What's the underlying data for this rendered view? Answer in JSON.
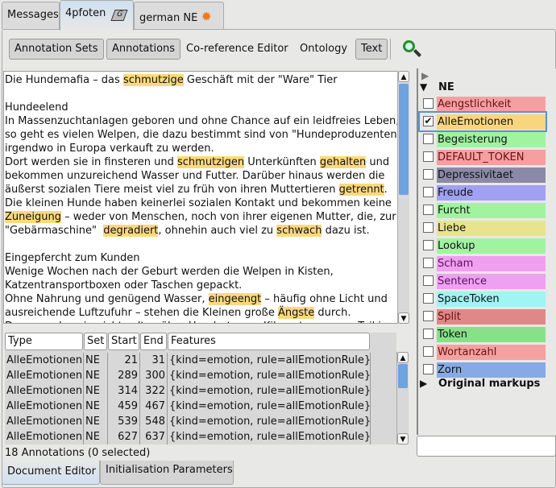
{
  "top_tabs": [
    {
      "label": "Messages"
    },
    {
      "label": "4pfoten",
      "icon": "document-gate-icon"
    },
    {
      "label": "german NE",
      "icon": "gears-icon"
    }
  ],
  "toolbar": {
    "annotation_sets": "Annotation Sets",
    "annotations": "Annotations",
    "coref": "Co-reference Editor",
    "ontology": "Ontology",
    "text": "Text",
    "search_icon": "magnifier-icon"
  },
  "text_lines": [
    [
      {
        "t": "Die Hundemafia – das "
      },
      {
        "t": "schmutzige",
        "hl": true
      },
      {
        "t": " Geschäft mit der \"Ware\" Tier"
      }
    ],
    [
      {
        "t": ""
      }
    ],
    [
      {
        "t": "Hundeelend"
      }
    ],
    [
      {
        "t": "In Massenzuchtanlagen geboren und ohne Chance auf ein leidfreies Leben,"
      }
    ],
    [
      {
        "t": "so geht es vielen Welpen, die dazu bestimmt sind von \"Hundeproduzenten\""
      }
    ],
    [
      {
        "t": "irgendwo in Europa verkauft zu werden."
      }
    ],
    [
      {
        "t": "Dort werden sie in finsteren und "
      },
      {
        "t": "schmutzigen",
        "hl": true
      },
      {
        "t": " Unterkünften "
      },
      {
        "t": "gehalten",
        "hl": true
      },
      {
        "t": " und"
      }
    ],
    [
      {
        "t": "bekommen unzureichend Wasser und Futter. Darüber hinaus werden die"
      }
    ],
    [
      {
        "t": "äußerst sozialen Tiere meist viel zu früh von ihren Muttertieren "
      },
      {
        "t": "getrennt",
        "hl": true
      },
      {
        "t": "."
      }
    ],
    [
      {
        "t": "Die kleinen Hunde haben keinerlei sozialen Kontakt und bekommen keine"
      }
    ],
    [
      {
        "t": "Zuneigung",
        "hl": true
      },
      {
        "t": " – weder von Menschen, noch von ihrer eigenen Mutter, die, zur"
      }
    ],
    [
      {
        "t": "\"Gebärmaschine\"  "
      },
      {
        "t": "degradiert",
        "hl": true
      },
      {
        "t": ", ohnehin auch viel zu "
      },
      {
        "t": "schwach",
        "hl": true
      },
      {
        "t": " dazu ist."
      }
    ],
    [
      {
        "t": ""
      }
    ],
    [
      {
        "t": "Eingepfercht zum Kunden"
      }
    ],
    [
      {
        "t": "Wenige Wochen nach der Geburt werden die Welpen in Kisten,"
      }
    ],
    [
      {
        "t": "Katzentransportboxen oder Taschen gepackt."
      }
    ],
    [
      {
        "t": "Ohne Nahrung und genügend Wasser, "
      },
      {
        "t": "eingeengt",
        "hl": true
      },
      {
        "t": " – häufig ohne Licht und"
      }
    ],
    [
      {
        "t": "ausreichende Luftzufuhr – stehen die Kleinen große "
      },
      {
        "t": "Ängste",
        "hl": true
      },
      {
        "t": " durch."
      }
    ],
    [
      {
        "t": "Dann werden sie nicht selten über Hunderte von Kilometern – zum Teil ins"
      }
    ]
  ],
  "table": {
    "columns": [
      "Type",
      "Set",
      "Start",
      "End",
      "Features"
    ],
    "rows": [
      [
        "AlleEmotionen",
        "NE",
        "21",
        "31",
        "{kind=emotion, rule=allEmotionRule}"
      ],
      [
        "AlleEmotionen",
        "NE",
        "289",
        "300",
        "{kind=emotion, rule=allEmotionRule}"
      ],
      [
        "AlleEmotionen",
        "NE",
        "314",
        "322",
        "{kind=emotion, rule=allEmotionRule}"
      ],
      [
        "AlleEmotionen",
        "NE",
        "459",
        "467",
        "{kind=emotion, rule=allEmotionRule}"
      ],
      [
        "AlleEmotionen",
        "NE",
        "539",
        "548",
        "{kind=emotion, rule=allEmotionRule}"
      ],
      [
        "AlleEmotionen",
        "NE",
        "627",
        "637",
        "{kind=emotion, rule=allEmotionRule}"
      ]
    ]
  },
  "status": "18 Annotations (0 selected)",
  "bottom_tabs": [
    "Document Editor",
    "Initialisation Parameters"
  ],
  "sets": {
    "group": "NE",
    "other": "Original markups",
    "items": [
      {
        "label": "Aengstlichkeit",
        "color": "#f4a0a0",
        "checked": false
      },
      {
        "label": "AlleEmotionen",
        "color": "#f8d57e",
        "checked": true
      },
      {
        "label": "Begeisterung",
        "color": "#a0f4a0",
        "checked": false
      },
      {
        "label": "DEFAULT_TOKEN",
        "color": "#f4a0a0",
        "checked": false
      },
      {
        "label": "Depressivitaet",
        "color": "#8a8aa8",
        "checked": false
      },
      {
        "label": "Freude",
        "color": "#a0a0f4",
        "checked": false
      },
      {
        "label": "Furcht",
        "color": "#a0f4a0",
        "checked": false
      },
      {
        "label": "Liebe",
        "color": "#e8e48e",
        "checked": false
      },
      {
        "label": "Lookup",
        "color": "#a0f4a0",
        "checked": false
      },
      {
        "label": "Scham",
        "color": "#f0a0f0",
        "checked": false
      },
      {
        "label": "Sentence",
        "color": "#f0a0f0",
        "checked": false
      },
      {
        "label": "SpaceToken",
        "color": "#a0f4f4",
        "checked": false
      },
      {
        "label": "Split",
        "color": "#e08888",
        "checked": false
      },
      {
        "label": "Token",
        "color": "#88e088",
        "checked": false
      },
      {
        "label": "Wortanzahl",
        "color": "#f4a0a0",
        "checked": false
      },
      {
        "label": "Zorn",
        "color": "#88aae4",
        "checked": false
      }
    ]
  },
  "search_input": {
    "value": ""
  }
}
